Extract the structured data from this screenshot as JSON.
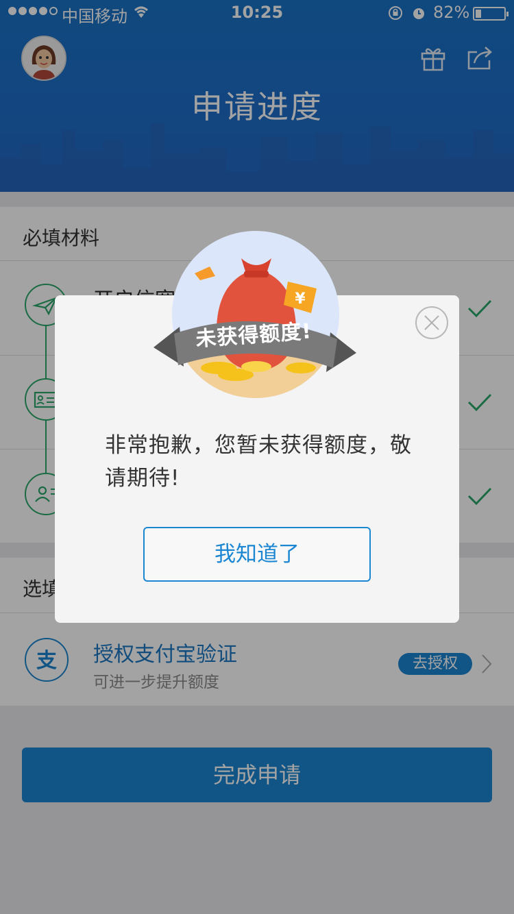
{
  "status_bar": {
    "carrier": "中国移动",
    "time": "10:25",
    "battery_percent": "82%"
  },
  "header": {
    "title": "申请进度"
  },
  "required_section": {
    "title": "必填材料",
    "steps": [
      {
        "label": "开启信宽",
        "icon": "paper-plane-icon",
        "done": true
      },
      {
        "label": "",
        "icon": "id-card-icon",
        "done": true
      },
      {
        "label": "",
        "icon": "contacts-icon",
        "done": true
      }
    ]
  },
  "optional_section": {
    "title": "选填",
    "alipay": {
      "title": "授权支付宝验证",
      "subtitle": "可进一步提升额度",
      "action": "去授权"
    }
  },
  "submit_label": "完成申请",
  "dialog": {
    "ribbon": "未获得额度!",
    "message": "非常抱歉，您暂未获得额度，敬请期待!",
    "ok_label": "我知道了"
  },
  "colors": {
    "header_blue": "#1a72c6",
    "accent_blue": "#1b86d2",
    "green": "#2aa86b"
  }
}
